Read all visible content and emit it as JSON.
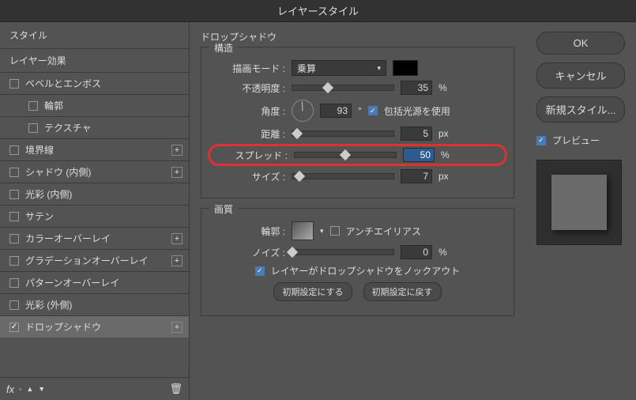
{
  "title": "レイヤースタイル",
  "sidebar": {
    "styles": "スタイル",
    "effects": "レイヤー効果",
    "items": [
      {
        "label": "ベベルとエンボス",
        "plus": false
      },
      {
        "label": "輪郭",
        "indent": true
      },
      {
        "label": "テクスチャ",
        "indent": true
      },
      {
        "label": "境界線",
        "plus": true
      },
      {
        "label": "シャドウ (内側)",
        "plus": true
      },
      {
        "label": "光彩 (内側)"
      },
      {
        "label": "サテン"
      },
      {
        "label": "カラーオーバーレイ",
        "plus": true
      },
      {
        "label": "グラデーションオーバーレイ",
        "plus": true
      },
      {
        "label": "パターンオーバーレイ"
      },
      {
        "label": "光彩 (外側)"
      },
      {
        "label": "ドロップシャドウ",
        "checked": true,
        "active": true,
        "plus": true
      }
    ]
  },
  "main": {
    "heading": "ドロップシャドウ",
    "structure": {
      "legend": "構造",
      "blend_label": "描画モード :",
      "blend_mode": "乗算",
      "opacity_label": "不透明度 :",
      "opacity": "35",
      "pct": "%",
      "angle_label": "角度 :",
      "angle": "93",
      "deg": "°",
      "global_label": "包括光源を使用",
      "distance_label": "距離 :",
      "distance": "5",
      "px": "px",
      "spread_label": "スプレッド :",
      "spread": "50",
      "size_label": "サイズ :",
      "size": "7"
    },
    "quality": {
      "legend": "画質",
      "contour_label": "輪郭 :",
      "antialias_label": "アンチエイリアス",
      "noise_label": "ノイズ :",
      "noise": "0",
      "knockout_label": "レイヤーがドロップシャドウをノックアウト",
      "make_default": "初期設定にする",
      "reset_default": "初期設定に戻す"
    }
  },
  "right": {
    "ok": "OK",
    "cancel": "キャンセル",
    "newstyle": "新規スタイル...",
    "preview": "プレビュー"
  }
}
